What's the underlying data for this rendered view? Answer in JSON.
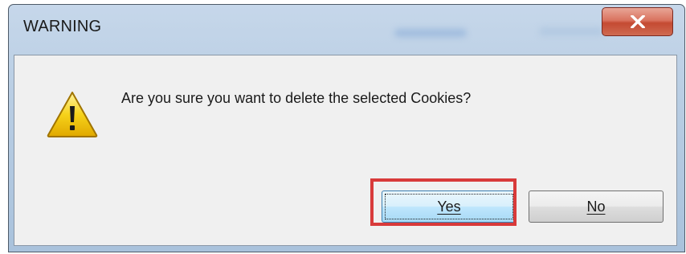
{
  "window": {
    "title": "WARNING",
    "close_icon": "close-icon"
  },
  "dialog": {
    "icon": "warning-icon",
    "message": "Are you sure you want to delete the selected Cookies?",
    "buttons": {
      "yes_label": "Yes",
      "no_label": "No"
    },
    "highlighted_button": "Yes"
  },
  "colors": {
    "highlight": "#d83a3a",
    "close_button": "#c44a32",
    "warning_yellow": "#f6c400"
  }
}
